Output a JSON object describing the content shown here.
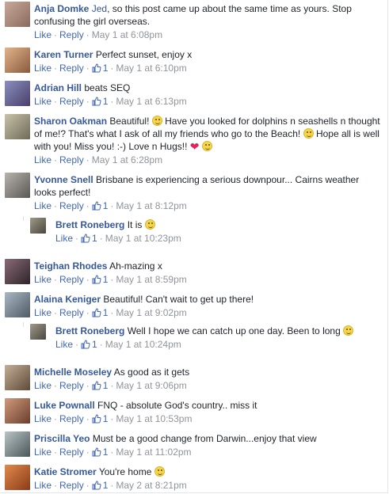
{
  "labels": {
    "like": "Like",
    "reply": "Reply",
    "separator": "·"
  },
  "comments": [
    {
      "author": "Anja Domke",
      "tag": "Jed",
      "text": ", so this post came up about the same time as yours. Stop confusing the girl overseas.",
      "likes": "",
      "time": "May 1 at 6:08pm",
      "avatar_color": "#9a7b6e"
    },
    {
      "author": "Karen Turner",
      "text": "Perfect sunset, enjoy x",
      "likes": "1",
      "time": "May 1 at 6:10pm",
      "avatar_color": "#b08a6a"
    },
    {
      "author": "Adrian Hill",
      "text": "beats SEQ",
      "likes": "1",
      "time": "May 1 at 6:13pm",
      "avatar_color": "#6b6f9a"
    },
    {
      "author": "Sharon Oakman",
      "text_parts": [
        "Beautiful!",
        "Have you looked for dolphins n seashells n thought of me!? That's what I ask of all my friends who go to the Beach!",
        "Hope all is well with you! Miss you! :-) Love n Hugs!!"
      ],
      "likes": "",
      "time": "May 1 at 6:28pm",
      "avatar_color": "#8d8a7a"
    },
    {
      "author": "Yvonne Snell",
      "text": "Brisbane is experiencing a serious downpour... Cairns weather looks perfect!",
      "likes": "1",
      "time": "May 1 at 8:12pm",
      "avatar_color": "#7e7c78"
    },
    {
      "author": "Brett Roneberg",
      "text": "It is",
      "likes": "1",
      "time": "May 1 at 10:23pm",
      "avatar_color": "#6e6a60"
    },
    {
      "author": "Teighan Rhodes",
      "text": "Ah-mazing x",
      "likes": "1",
      "time": "May 1 at 8:59pm",
      "avatar_color": "#5a4c52"
    },
    {
      "author": "Alaina Keniger",
      "text": "Beautiful! Can't wait to get up there!",
      "likes": "1",
      "time": "May 1 at 9:02pm",
      "avatar_color": "#7d8a95"
    },
    {
      "author": "Brett Roneberg",
      "text": "Well I hope we can catch up one day. Been to long",
      "likes": "1",
      "time": "May 1 at 10:24pm",
      "avatar_color": "#6e6a60"
    },
    {
      "author": "Michelle Moseley",
      "text": "As good as it gets",
      "likes": "1",
      "time": "May 1 at 9:06pm",
      "avatar_color": "#8a7a6a"
    },
    {
      "author": "Luke Pownall",
      "text": "FNQ - absolute God's country.. miss it",
      "likes": "1",
      "time": "May 1 at 10:53pm",
      "avatar_color": "#9c6e58"
    },
    {
      "author": "Priscilla Yeo",
      "text": "Must be a good change from Darwin...enjoy that view",
      "likes": "1",
      "time": "May 1 at 11:02pm",
      "avatar_color": "#7a8a8e"
    },
    {
      "author": "Katie Stromer",
      "text": "You're home",
      "likes": "1",
      "time": "May 2 at 8:21pm",
      "avatar_color": "#c07040"
    }
  ]
}
